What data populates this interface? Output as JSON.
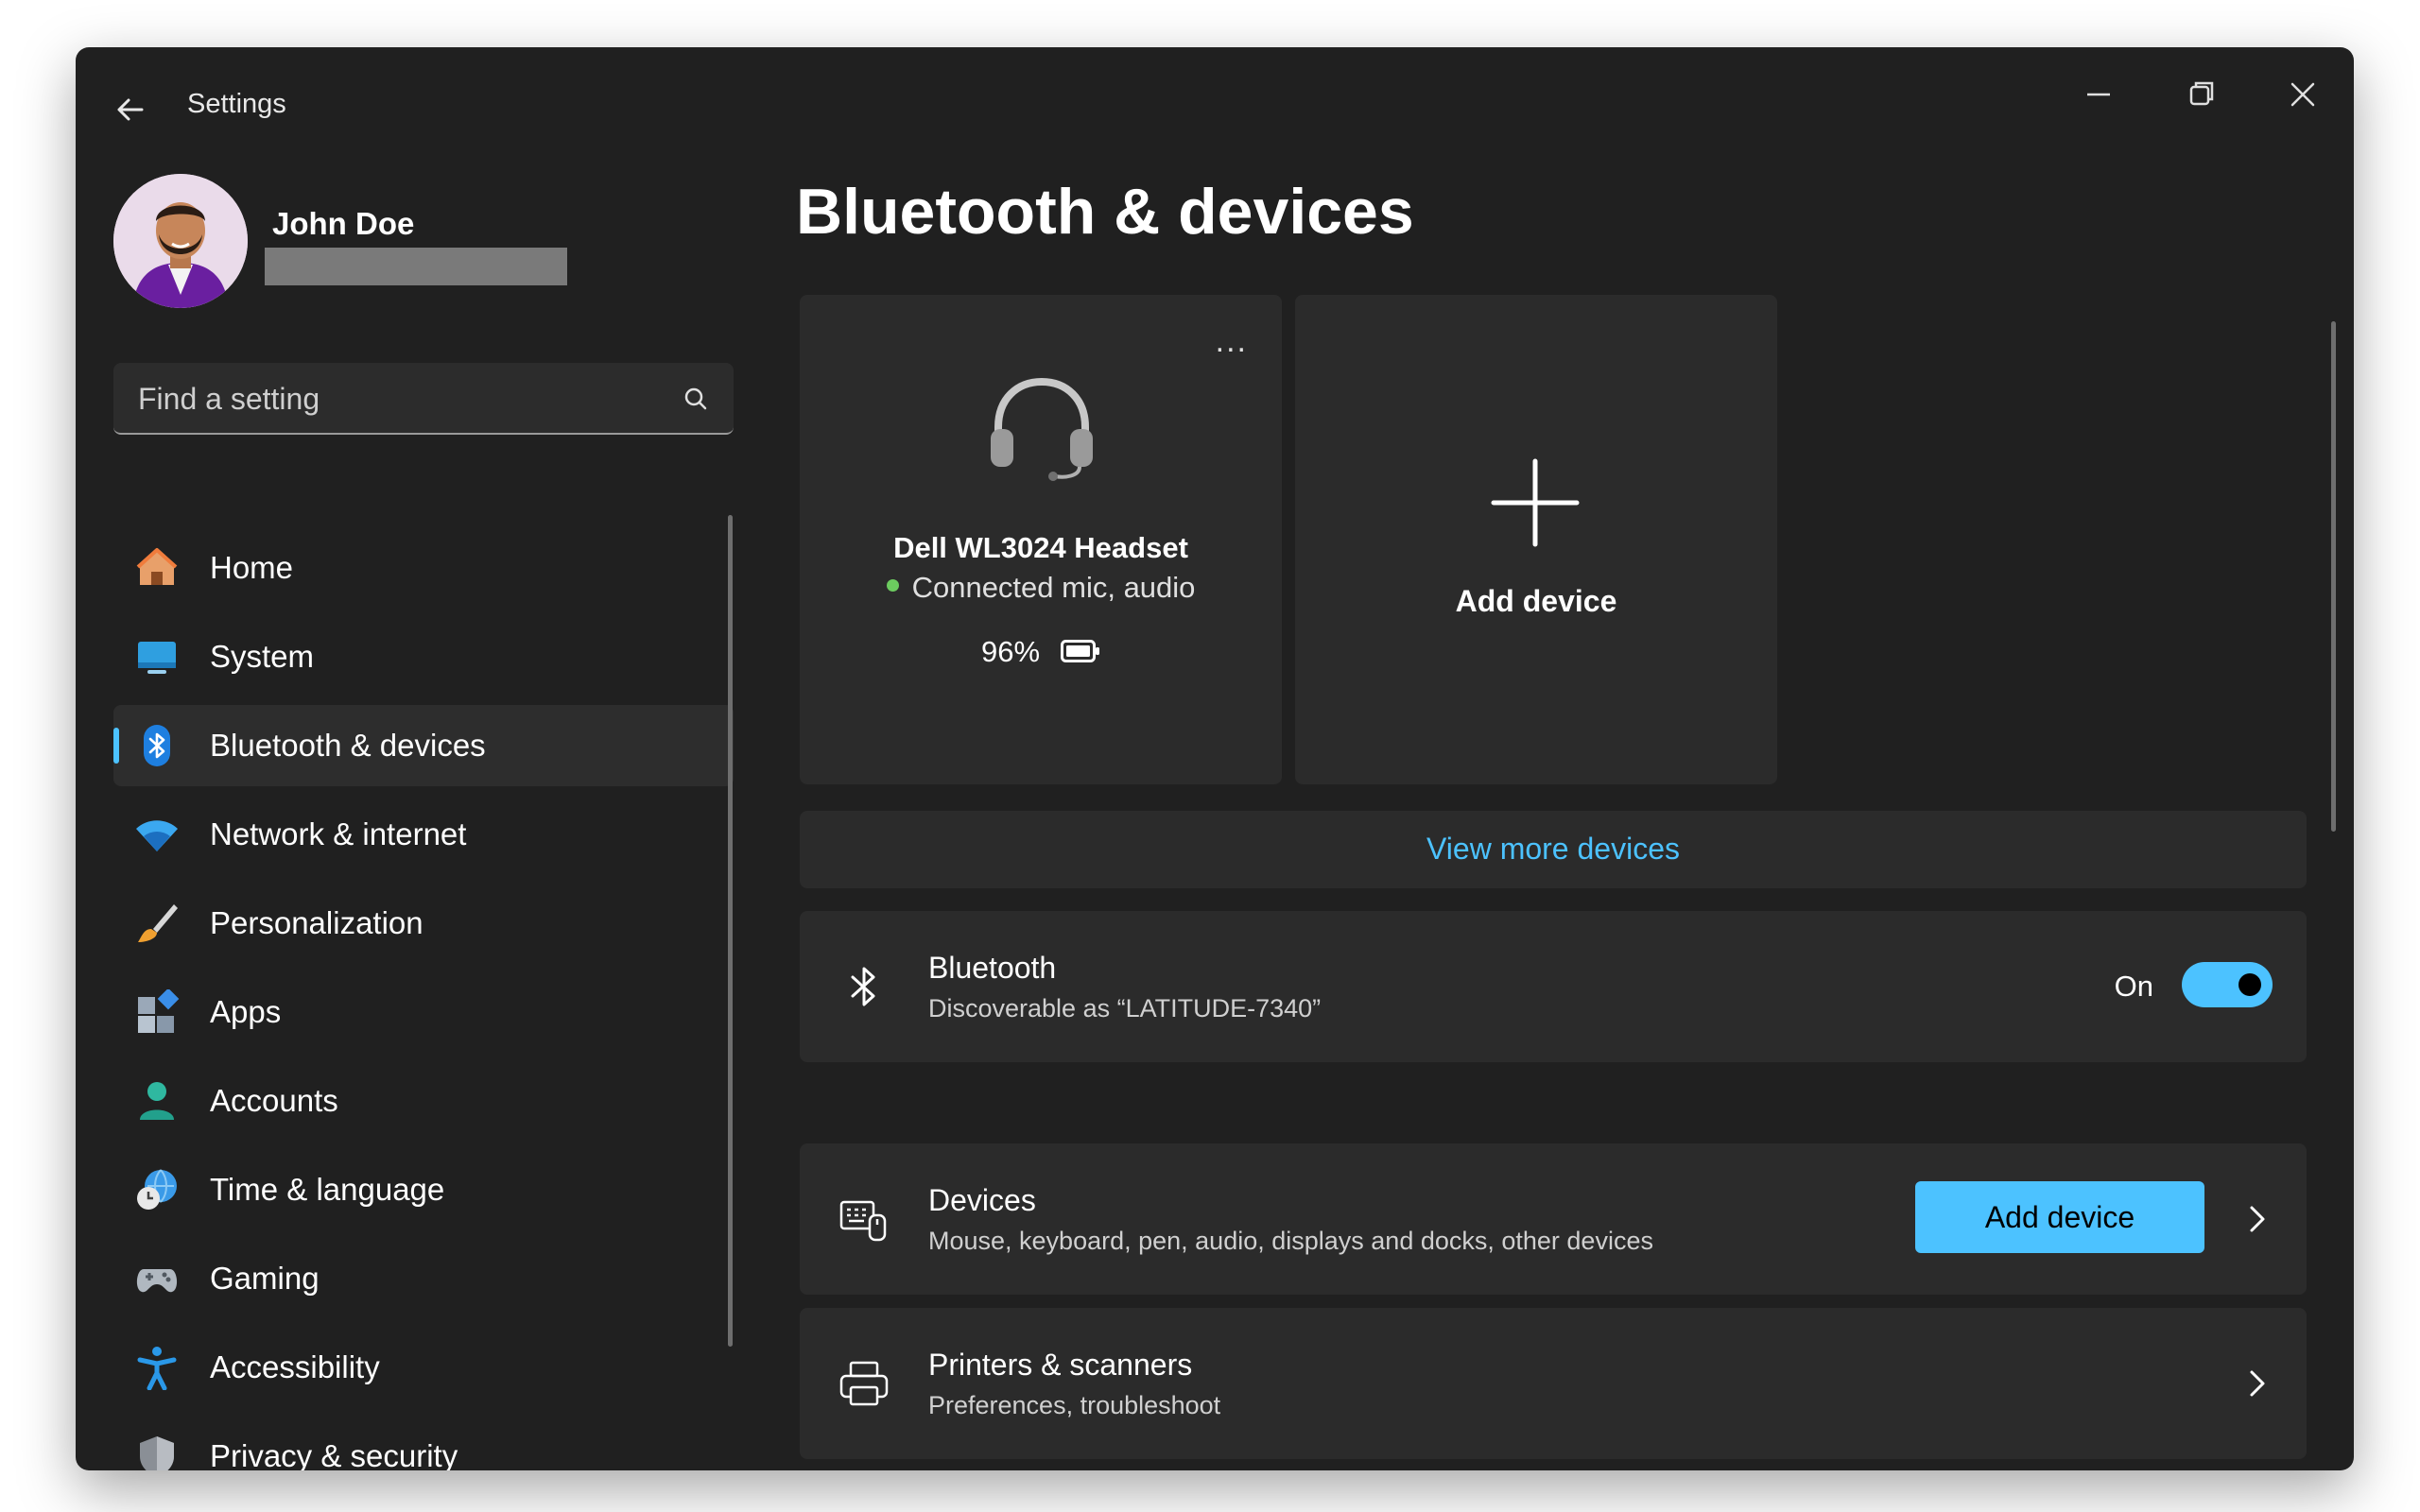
{
  "window": {
    "title": "Settings"
  },
  "user": {
    "name": "John Doe"
  },
  "search": {
    "placeholder": "Find a setting"
  },
  "sidebar": {
    "items": [
      {
        "label": "Home",
        "icon": "home-icon"
      },
      {
        "label": "System",
        "icon": "system-icon"
      },
      {
        "label": "Bluetooth & devices",
        "icon": "bluetooth-icon",
        "active": true
      },
      {
        "label": "Network & internet",
        "icon": "wifi-icon"
      },
      {
        "label": "Personalization",
        "icon": "brush-icon"
      },
      {
        "label": "Apps",
        "icon": "apps-icon"
      },
      {
        "label": "Accounts",
        "icon": "accounts-icon"
      },
      {
        "label": "Time & language",
        "icon": "globe-clock-icon"
      },
      {
        "label": "Gaming",
        "icon": "gamepad-icon"
      },
      {
        "label": "Accessibility",
        "icon": "accessibility-icon"
      },
      {
        "label": "Privacy & security",
        "icon": "shield-icon"
      }
    ]
  },
  "main": {
    "title": "Bluetooth & devices",
    "device_card": {
      "name": "Dell WL3024 Headset",
      "status": "Connected mic, audio",
      "battery": "96%",
      "icon": "headset-icon",
      "menu": "..."
    },
    "add_card": {
      "label": "Add device",
      "icon": "plus-icon"
    },
    "view_more": "View more devices",
    "bluetooth": {
      "title": "Bluetooth",
      "subtitle": "Discoverable as “LATITUDE-7340”",
      "state_label": "On",
      "enabled": true
    },
    "devices_row": {
      "title": "Devices",
      "subtitle": "Mouse, keyboard, pen, audio, displays and docks, other devices",
      "button": "Add device"
    },
    "printers_row": {
      "title": "Printers & scanners",
      "subtitle": "Preferences, troubleshoot"
    }
  },
  "colors": {
    "accent": "#4cc2ff",
    "window_bg": "#202020",
    "card_bg": "#2b2b2b",
    "status_green": "#6ccb5f"
  }
}
